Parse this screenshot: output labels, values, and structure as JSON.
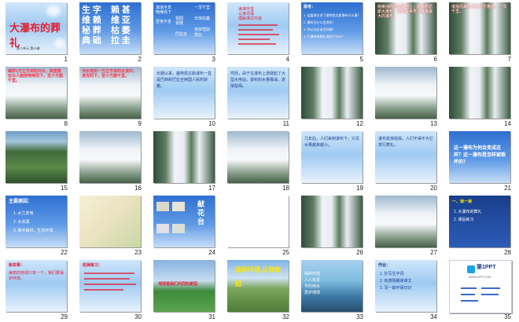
{
  "slides": [
    {
      "num": "1",
      "title": "大瀑布的葬礼",
      "subtitle": "第八单元 第29课"
    },
    {
      "num": "2",
      "col1": [
        "生 字",
        "维 赖",
        "秘 葬",
        "典 础"
      ],
      "col2": [
        "赖 甚",
        "维 亚",
        "枯 萎",
        "拉 圭"
      ]
    },
    {
      "num": "3",
      "col1": [
        "滚滚不息",
        "咆哮而下",
        "昼夜不息"
      ],
      "col2": [
        "一泻千里",
        "日渐枯萎",
        "依依惜别",
        "悲壮"
      ],
      "col3": [
        "祖国",
        "衰微",
        "巴拉圭"
      ]
    },
    {
      "num": "4",
      "lines": [
        "读准字音",
        "认读词语",
        "理解课文内容"
      ]
    },
    {
      "num": "5",
      "heading": "思考：",
      "lines": [
        "1. 这篇课文讲了塞特凯达斯瀑布什么事？",
        "2. 瀑布为什么会消失？",
        "3. 你认为应该怎样做？",
        "4. 大瀑布的葬礼说明了什么？"
      ]
    },
    {
      "num": "6",
      "text": "南美洲的巴拉那河上，塞特凯达斯大瀑布，曾经是世界上流量最大的瀑布。"
    },
    {
      "num": "7",
      "text": "滚滚而来的河水冲下悬崖，一泻千里。"
    },
    {
      "num": "8",
      "text": "每秒1万立方米的河水，简直要在众人面前咆哮而下，至少方圆千里。"
    },
    {
      "num": "9",
      "text": "河水宛如一万立方米的水流中，流泻而下，至少方圆千里。"
    },
    {
      "num": "10",
      "text": "长期以来，塞特凯达斯瀑布一直是巴西和巴拉圭两国人民的骄傲。"
    },
    {
      "num": "11",
      "text": "然而，由于在瀑布上游建起了大型水电站，瀑布的水量骤减，逐渐枯竭。"
    },
    {
      "num": "12"
    },
    {
      "num": "13"
    },
    {
      "num": "14"
    },
    {
      "num": "15"
    },
    {
      "num": "16"
    },
    {
      "num": "17"
    },
    {
      "num": "18"
    },
    {
      "num": "19",
      "text": "几年后，人们来到瀑布下，只见水量越来越小。"
    },
    {
      "num": "20",
      "text": "瀑布逐渐枯竭，人们不得不为它举行葬礼。"
    },
    {
      "num": "21",
      "question": "这一瀑布为何会变成这样？这一瀑布是怎样被毁坏的？"
    },
    {
      "num": "22",
      "heading": "主要原因：",
      "lines": [
        "1. 水力发电",
        "2. 水资源",
        "3. 破坏森林、生态环境"
      ]
    },
    {
      "num": "23"
    },
    {
      "num": "24",
      "caption": "献花台"
    },
    {
      "num": "25"
    },
    {
      "num": "26"
    },
    {
      "num": "27"
    },
    {
      "num": "28",
      "heading": "一、读一读",
      "lines": [
        "1. 大瀑布的葬礼",
        "2. 课后练习"
      ]
    },
    {
      "num": "29",
      "heading": "新故事：",
      "text": "美丽的地球只有一个，我们要保护环境。"
    },
    {
      "num": "30",
      "heading": "拓展练习："
    },
    {
      "num": "31",
      "caption": "地球是我们共同的家园"
    },
    {
      "num": "32",
      "caption": "保护环境 从我做起"
    },
    {
      "num": "33",
      "lines": [
        "保护环境",
        "人人有责",
        "节约用水",
        "爱护地球"
      ]
    },
    {
      "num": "34",
      "heading": "作业：",
      "lines": [
        "1. 抄写生字词",
        "2. 有感情朗读课文",
        "3. 写一篇环保日记"
      ]
    },
    {
      "num": "35",
      "brand": "第1PPT",
      "url": "WWW.1PPT.COM"
    }
  ],
  "colors": {
    "text_red": "#e0203a",
    "text_blue": "#1a3c8c",
    "slide_sky": "#9fcaf2"
  }
}
